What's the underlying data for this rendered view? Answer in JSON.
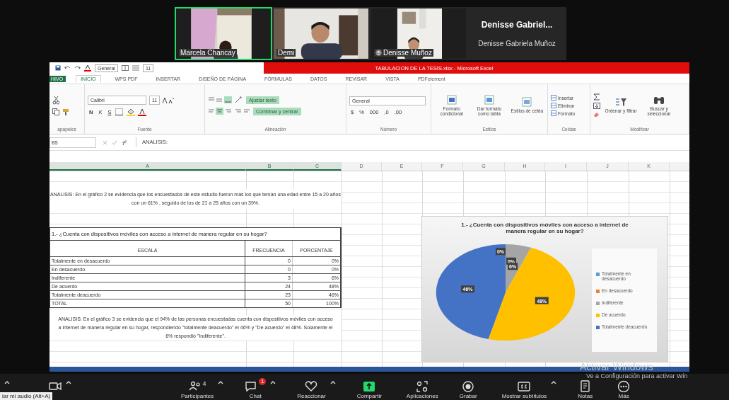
{
  "meeting": {
    "video_tiles": [
      {
        "kind": "video",
        "name": "Marcela  Chancay",
        "selected": true
      },
      {
        "kind": "video",
        "name": "Demi",
        "selected": false
      },
      {
        "kind": "video",
        "name": "Denisse Muñoz",
        "selected": false
      },
      {
        "kind": "name_only",
        "title": "Denisse  Gabriel...",
        "name": "Denisse Gabriela Muñoz",
        "selected": false
      }
    ]
  },
  "excel": {
    "quick_access": {
      "style_field": "General",
      "size_field": "11"
    },
    "title": "TABULACION DE LA TESIS.xlsx - Microsoft Excel",
    "tabs": [
      {
        "label": "HIVO",
        "kind": "file",
        "selected": false
      },
      {
        "label": "INICIO",
        "kind": "tab",
        "selected": true
      },
      {
        "label": "WPS PDF",
        "kind": "tab",
        "selected": false
      },
      {
        "label": "INSERTAR",
        "kind": "tab",
        "selected": false
      },
      {
        "label": "DISEÑO DE PÁGINA",
        "kind": "tab",
        "selected": false
      },
      {
        "label": "FÓRMULAS",
        "kind": "tab",
        "selected": false
      },
      {
        "label": "DATOS",
        "kind": "tab",
        "selected": false
      },
      {
        "label": "REVISAR",
        "kind": "tab",
        "selected": false
      },
      {
        "label": "VISTA",
        "kind": "tab",
        "selected": false
      },
      {
        "label": "PDFelement",
        "kind": "tab",
        "selected": false
      }
    ],
    "ribbon": [
      {
        "kind": "clipboard",
        "label": "apapeles"
      },
      {
        "kind": "font",
        "label": "Fuente",
        "font": "Calibri",
        "size": "11",
        "style_buttons": [
          "N",
          "K",
          "S"
        ]
      },
      {
        "kind": "alignment",
        "label": "Alineación",
        "wrap": "Ajustar texto",
        "merge": "Combinar y centrar"
      },
      {
        "kind": "number",
        "label": "Número",
        "format": "General",
        "buttons": [
          "$",
          "%",
          "000",
          ",0",
          ",00"
        ]
      },
      {
        "kind": "styles",
        "label": "Estilos",
        "buttons": [
          "Formato condicional",
          "Dar formato como tabla",
          "Estilos de celda"
        ]
      },
      {
        "kind": "cells",
        "label": "Celdas",
        "buttons": [
          "Insertar",
          "Eliminar",
          "Formato"
        ]
      },
      {
        "kind": "editing",
        "label": "Modificar",
        "buttons": [
          "Ordenar y filtrar",
          "Buscar y seleccionar"
        ]
      }
    ],
    "formula_bar": {
      "name_box": "B5",
      "formula": "ANALISIS:"
    }
  },
  "sheet": {
    "columns": [
      {
        "label": "A",
        "selected": true
      },
      {
        "label": "B",
        "selected": true
      },
      {
        "label": "C",
        "selected": true
      },
      {
        "label": "D",
        "selected": false
      },
      {
        "label": "E",
        "selected": false
      },
      {
        "label": "F",
        "selected": false
      },
      {
        "label": "G",
        "selected": false
      },
      {
        "label": "H",
        "selected": false
      },
      {
        "label": "I",
        "selected": false
      },
      {
        "label": "J",
        "selected": false
      },
      {
        "label": "K",
        "selected": false
      }
    ],
    "analysis_1": "ANALISIS: En el gráfico 2 se evidencia que los encuestados de este estudio fueron más los que tenían una edad entre 15 a 20 años con un 61% , seguido de los de 21 a 25 años con un 39%.",
    "table": {
      "title": "1.- ¿Cuenta con dispositivos móviles con acceso a internet de manera regular en su hogar?",
      "columns": [
        "ESCALA",
        "FRECUENCIA",
        "PORCENTAJE"
      ],
      "rows": [
        [
          "Totalmente en desacuerdo",
          "0",
          "0%"
        ],
        [
          "En desacuerdo",
          "0",
          "0%"
        ],
        [
          "Indiferente",
          "3",
          "6%"
        ],
        [
          "De acuerdo",
          "24",
          "48%"
        ],
        [
          "Totalmente deacuerdo",
          "23",
          "46%"
        ],
        [
          "TOTAL",
          "50",
          "100%"
        ]
      ]
    },
    "analysis_2": "ANALISIS: En el gráfico 3 se evidencia que el 94% de las personas encuestadas cuenta con dispositivos móviles con acceso a internet de manera regular en su hogar, respondiendo \"totalmente deacuerdo\" el 46% y \"De acuerdo\" el 48%. Solamente el 6% respondió \"Indiferente\".",
    "chart": {
      "chart_data": {
        "type": "pie",
        "title": "1.- ¿Cuenta con dispositivos móviles con acceso a internet de manera regular en su hogar?",
        "categories": [
          "Totalmente en desacuerdo",
          "En desacuerdo",
          "Indiferente",
          "De acuerdo",
          "Totalmente deacuerdo"
        ],
        "values": [
          0,
          0,
          6,
          48,
          46
        ],
        "legend": "right",
        "data_labels": true,
        "value_labels": [
          "0%",
          "0%",
          "6%",
          "48%",
          "46%"
        ]
      },
      "slices": [
        {
          "color": "#5b9bd5"
        },
        {
          "color": "#ed7d31"
        },
        {
          "color": "#a5a5a5"
        },
        {
          "color": "#ffc000"
        },
        {
          "color": "#4472c4"
        }
      ]
    }
  },
  "watermark": {
    "title": "Activar Windows",
    "text": "Ve a Configuración para activar Win"
  },
  "toolbar": {
    "tooltip": "iar mi audio (Alt+A)",
    "buttons": [
      {
        "kind": "audio",
        "caret": true
      },
      {
        "kind": "video",
        "caret": true
      },
      {
        "kind": "participants",
        "label": "Participantes",
        "count": "4",
        "caret": true
      },
      {
        "kind": "chat",
        "label": "Chat",
        "badge": "1",
        "caret": true
      },
      {
        "kind": "react",
        "label": "Reaccionar",
        "caret": true
      },
      {
        "kind": "share",
        "label": "Compartir",
        "caret": false
      },
      {
        "kind": "apps",
        "label": "Aplicaciones",
        "caret": false
      },
      {
        "kind": "record",
        "label": "Grabar",
        "caret": false
      },
      {
        "kind": "captions",
        "label": "Mostrar subtítulos",
        "caret": true
      },
      {
        "kind": "notes",
        "label": "Notas",
        "caret": false
      },
      {
        "kind": "more",
        "label": "Más",
        "caret": false
      }
    ]
  }
}
